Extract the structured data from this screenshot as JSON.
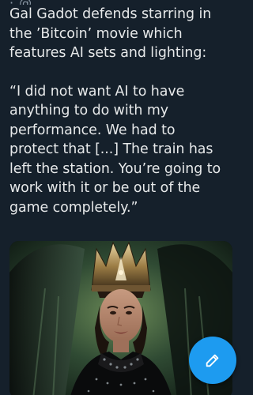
{
  "post": {
    "header_fragment": "· @…",
    "paragraph1": "Gal Gadot defends starring in\nthe ’Bitcoin’ movie which\nfeatures AI sets and lighting:",
    "paragraph2": "“I did not want AI to have\nanything to do with my\nperformance. We had to\nprotect that [...] The train has\nleft the station. You’re going to\nwork with it or be out of the\ngame completely.”"
  },
  "media": {
    "image_subject": "actress-in-ornate-crown-portrait"
  },
  "compose_button": {
    "icon": "compose-icon"
  },
  "colors": {
    "background": "#15202b",
    "text": "#e7e9ea",
    "accent": "#1d9bf0"
  }
}
